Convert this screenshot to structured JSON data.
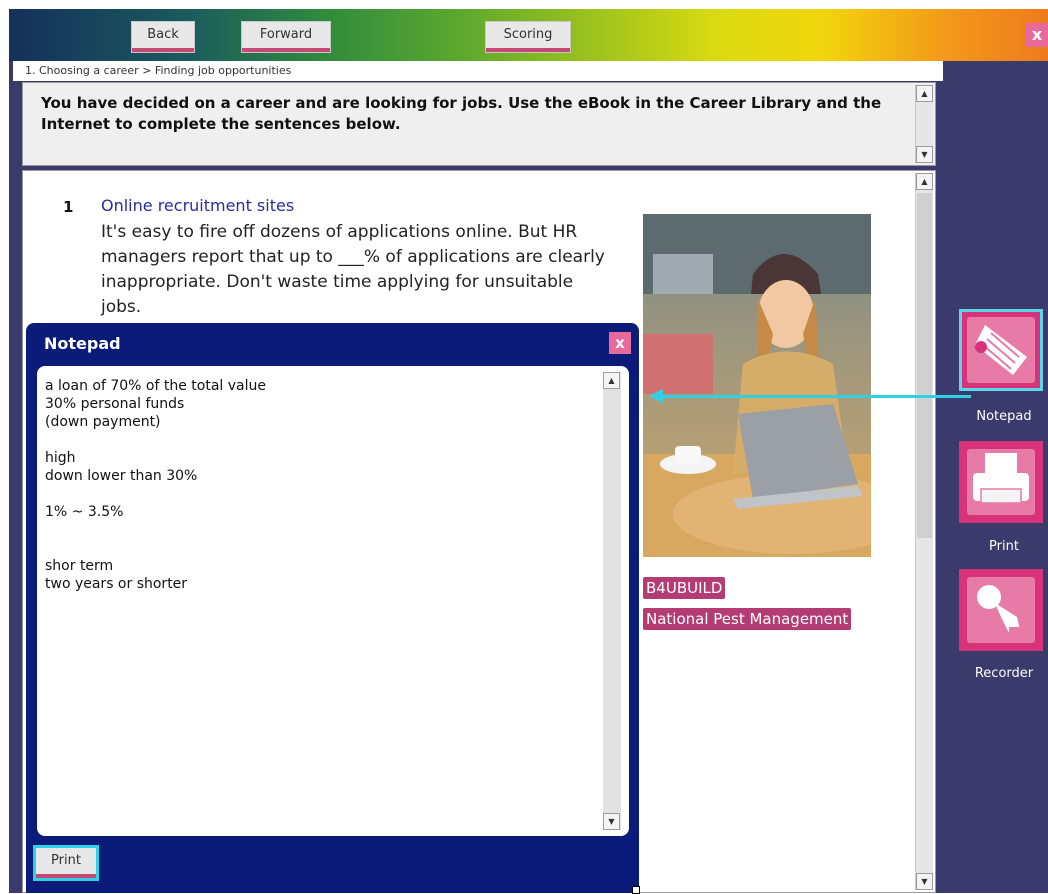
{
  "toolbar": {
    "back_label": "Back",
    "forward_label": "Forward",
    "scoring_label": "Scoring",
    "close_glyph": "x"
  },
  "breadcrumb": "1. Choosing a career > Finding job opportunities",
  "instructions": "You have decided on a career and are looking for jobs. Use the eBook in the Career Library and the Internet to complete the sentences below.",
  "question": {
    "number": "1",
    "title": "Online recruitment sites",
    "body": "It's easy to fire off dozens of applications online. But HR managers report that up to ___% of applications are clearly inappropriate. Don't waste time applying for unsuitable jobs."
  },
  "links": [
    "B4UBUILD",
    "National Pest Management"
  ],
  "sidebar": {
    "notepad_label": "Notepad",
    "print_label": "Print",
    "recorder_label": "Recorder"
  },
  "notepad": {
    "title": "Notepad",
    "close_glyph": "x",
    "text": "a loan of 70% of the total value\n30% personal funds\n(down payment)\n\nhigh\ndown lower than 30%\n\n1% ~ 3.5%\n\n\nshor term\ntwo years or shorter",
    "print_label": "Print"
  },
  "colors": {
    "accent_pink": "#d8337a",
    "notepad_blue": "#0b1b7a",
    "highlight_cyan": "#2ed2e4"
  }
}
